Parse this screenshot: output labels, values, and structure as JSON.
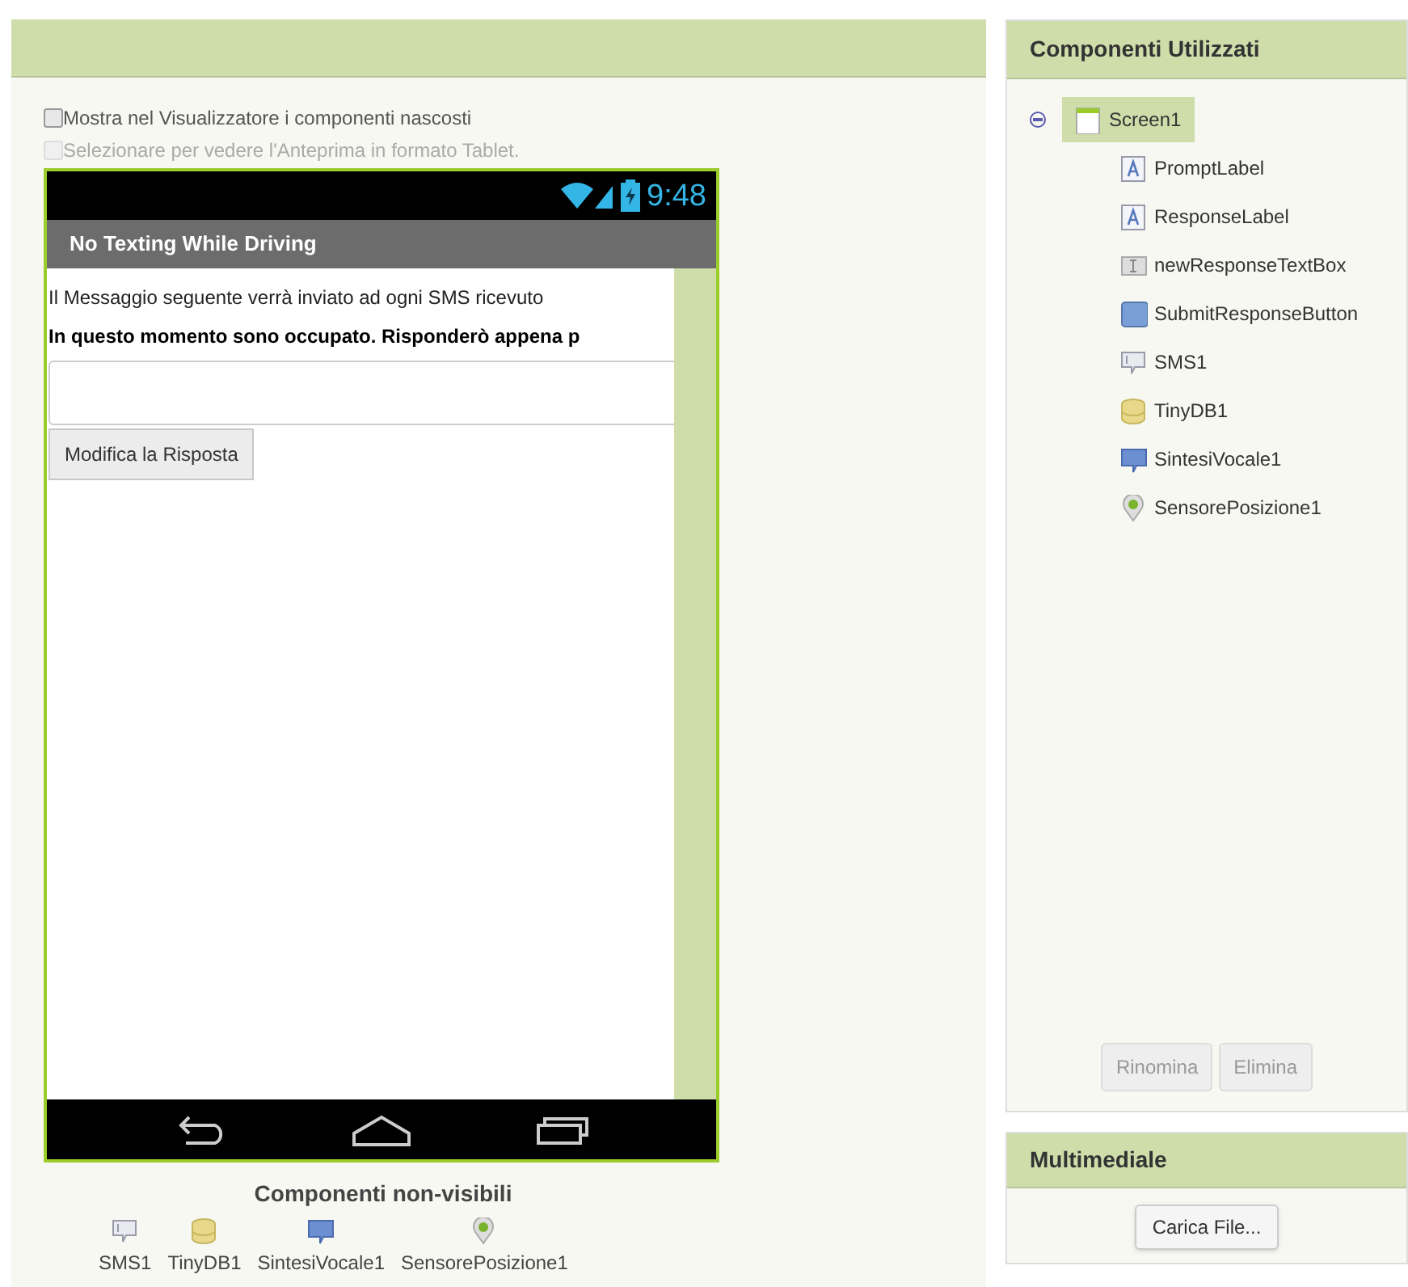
{
  "options": [
    {
      "label": "Mostra nel Visualizzatore i componenti nascosti",
      "checked": false,
      "disabled": false
    },
    {
      "label": "Selezionare per vedere l'Anteprima in formato Tablet.",
      "checked": false,
      "disabled": true
    }
  ],
  "phone": {
    "time": "9:48",
    "title": "No Texting While Driving",
    "prompt": "Il Messaggio seguente verrà inviato ad ogni SMS ricevuto",
    "response": "In questo momento sono occupato. Risponderò appena p",
    "button": "Modifica la Risposta"
  },
  "non_visible": {
    "title": "Componenti non-visibili",
    "items": [
      {
        "kind": "sms",
        "label": "SMS1"
      },
      {
        "kind": "tinydb",
        "label": "TinyDB1"
      },
      {
        "kind": "tts",
        "label": "SintesiVocale1"
      },
      {
        "kind": "location",
        "label": "SensorePosizione1"
      }
    ]
  },
  "components": {
    "title": "Componenti Utilizzati",
    "tree": [
      {
        "kind": "screen",
        "label": "Screen1",
        "selected": true,
        "expanded": true,
        "children": [
          {
            "kind": "label",
            "label": "PromptLabel",
            "selected": false
          },
          {
            "kind": "label",
            "label": "ResponseLabel",
            "selected": false
          },
          {
            "kind": "textbox",
            "label": "newResponseTextBox",
            "selected": false
          },
          {
            "kind": "button",
            "label": "SubmitResponseButton",
            "selected": false
          },
          {
            "kind": "sms",
            "label": "SMS1",
            "selected": false
          },
          {
            "kind": "tinydb",
            "label": "TinyDB1",
            "selected": false
          },
          {
            "kind": "tts",
            "label": "SintesiVocale1",
            "selected": false
          },
          {
            "kind": "location",
            "label": "SensorePosizione1",
            "selected": false
          }
        ]
      }
    ],
    "buttons": [
      "Rinomina",
      "Elimina"
    ]
  },
  "media": {
    "title": "Multimediale",
    "button": "Carica File..."
  }
}
